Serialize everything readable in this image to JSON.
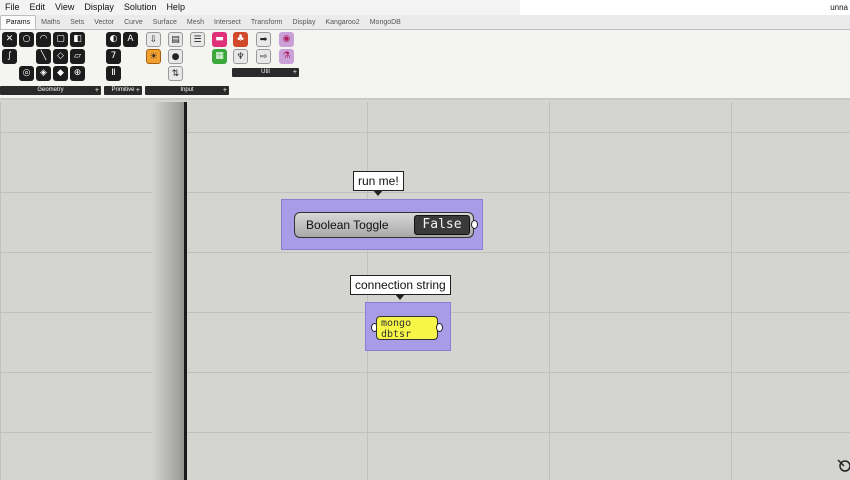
{
  "menubar": {
    "items": [
      "File",
      "Edit",
      "View",
      "Display",
      "Solution",
      "Help"
    ],
    "title": "unna"
  },
  "tabs": [
    "Params",
    "Maths",
    "Sets",
    "Vector",
    "Curve",
    "Surface",
    "Mesh",
    "Intersect",
    "Transform",
    "Display",
    "Kangaroo2",
    "MongoDB"
  ],
  "active_tab": "Params",
  "toolbar": {
    "groups": [
      {
        "label": "Geometry",
        "icon_names": [
          "point-icon",
          "circle-icon",
          "arc-icon",
          "box-icon",
          "brep-icon",
          "curve-icon",
          "line-icon",
          "mesh-icon",
          "plane-icon",
          "surface-icon",
          "twisted-box-icon",
          "field-icon",
          "geometry-icon",
          "group-icon",
          "transform-icon"
        ]
      },
      {
        "label": "Primitive",
        "icon_names": [
          "boolean-param-icon",
          "text-param-icon",
          "integer-param-icon",
          "number-param-icon",
          "time-param-icon"
        ]
      },
      {
        "label": "Input",
        "icon_names": [
          "import-icon",
          "value-list-icon",
          "panel-icon",
          "boolean-toggle-icon",
          "button-icon",
          "slider-icon",
          "gradient-icon",
          "colour-swatch-icon"
        ]
      },
      {
        "label": "Util",
        "icon_names": [
          "cherry-picker-icon",
          "data-dam-icon",
          "relay-icon",
          "tree-icon",
          "jump-icon",
          "flask-icon"
        ]
      }
    ]
  },
  "canvas": {
    "toggle_tooltip": "run me!",
    "toggle_label": "Boolean Toggle",
    "toggle_value": "False",
    "panel_tooltip": "connection string",
    "panel_text": "mongo dbtsr"
  }
}
